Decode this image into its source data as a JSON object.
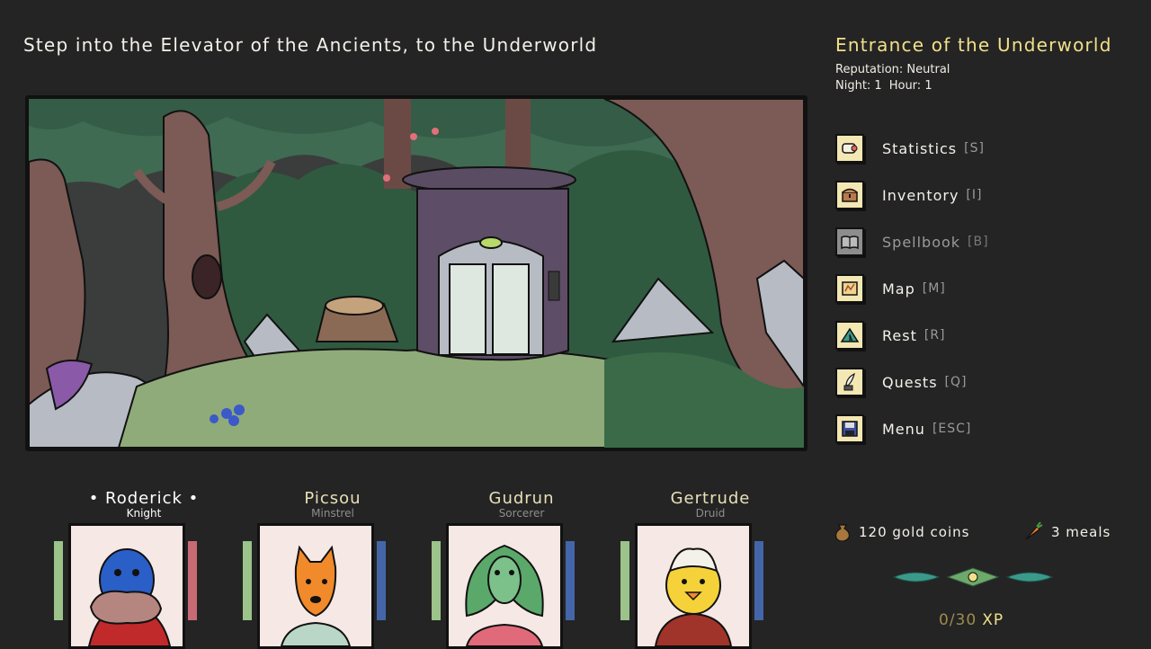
{
  "scene": {
    "title": "Step into the Elevator of the Ancients, to the Underworld"
  },
  "location": {
    "title": "Entrance of the Underworld",
    "reputation": "Reputation: Neutral",
    "night": "Night: 1",
    "hour": "Hour: 1"
  },
  "menu": [
    {
      "label": "Statistics",
      "key": "[S]",
      "icon": "scroll-icon",
      "enabled": true
    },
    {
      "label": "Inventory",
      "key": "[I]",
      "icon": "chest-icon",
      "enabled": true
    },
    {
      "label": "Spellbook",
      "key": "[B]",
      "icon": "book-icon",
      "enabled": false
    },
    {
      "label": "Map",
      "key": "[M]",
      "icon": "map-icon",
      "enabled": true
    },
    {
      "label": "Rest",
      "key": "[R]",
      "icon": "tent-icon",
      "enabled": true
    },
    {
      "label": "Quests",
      "key": "[Q]",
      "icon": "quill-icon",
      "enabled": true
    },
    {
      "label": "Menu",
      "key": "[ESC]",
      "icon": "floppy-disk-icon",
      "enabled": true
    }
  ],
  "party": [
    {
      "name": "• Roderick •",
      "class": "Knight",
      "active": true,
      "bar_color": "#c86b74",
      "portrait": "platypus"
    },
    {
      "name": "Picsou",
      "class": "Minstrel",
      "active": false,
      "bar_color": "#4466a8",
      "portrait": "fox"
    },
    {
      "name": "Gudrun",
      "class": "Sorcerer",
      "active": false,
      "bar_color": "#4466a8",
      "portrait": "cobra"
    },
    {
      "name": "Gertrude",
      "class": "Druid",
      "active": false,
      "bar_color": "#4466a8",
      "portrait": "chick"
    }
  ],
  "resources": {
    "gold": "120 gold coins",
    "meals": "3 meals"
  },
  "xp": {
    "value": "0/30",
    "unit": "XP"
  }
}
